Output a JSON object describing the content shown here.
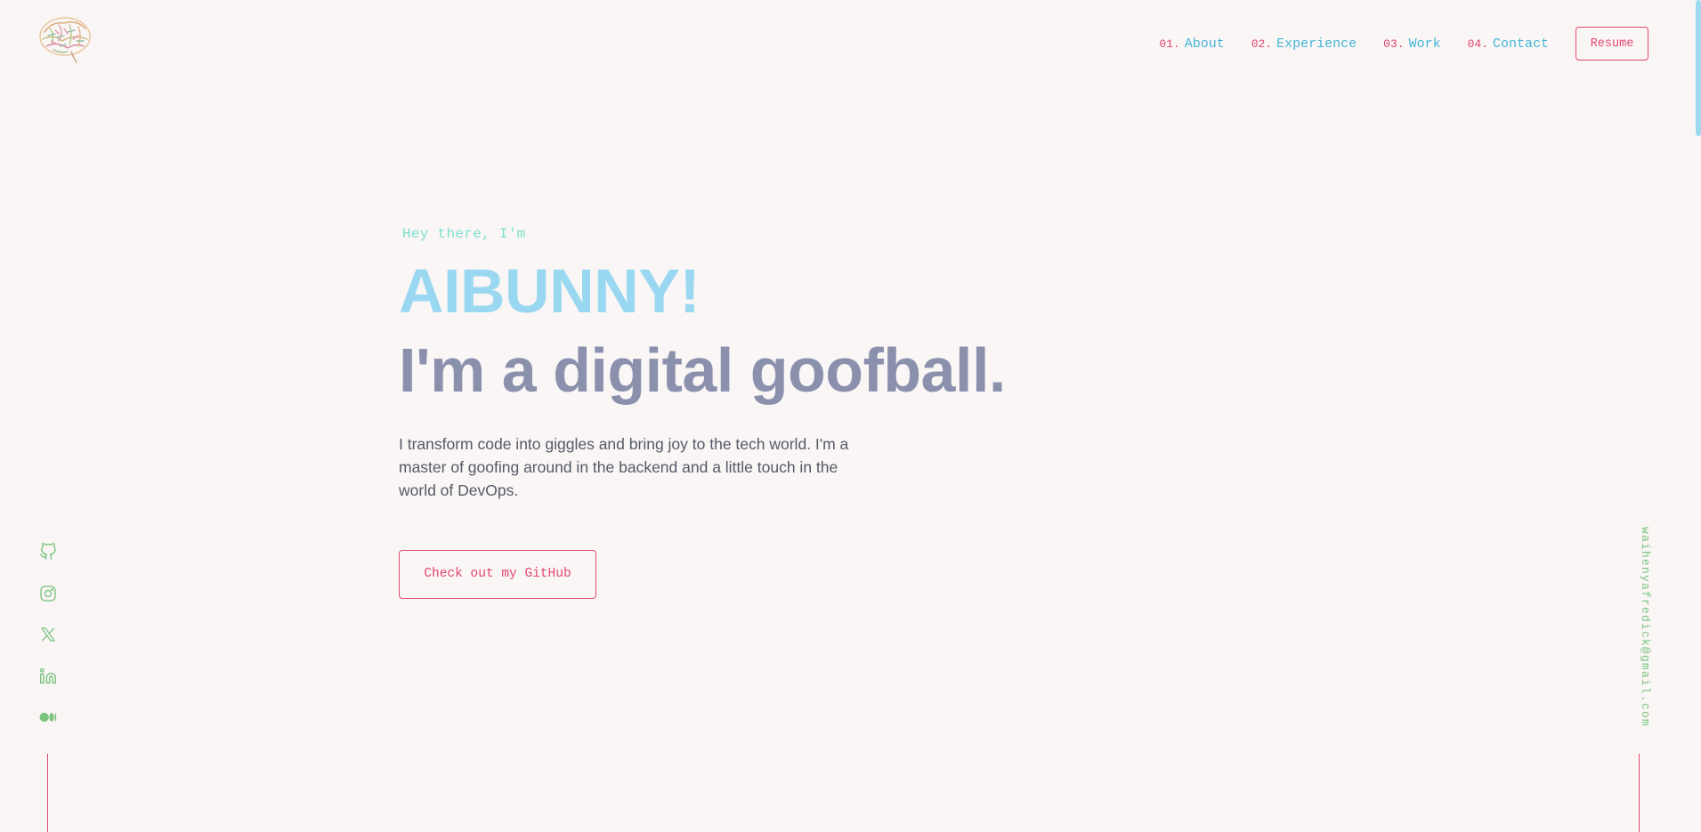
{
  "header": {
    "logo_icon": "brain-icon",
    "nav": [
      {
        "num": "01.",
        "label": "About"
      },
      {
        "num": "02.",
        "label": "Experience"
      },
      {
        "num": "03.",
        "label": "Work"
      },
      {
        "num": "04.",
        "label": "Contact"
      }
    ],
    "resume_label": "Resume"
  },
  "hero": {
    "greeting": "Hey there, I'm",
    "name": "AIBUNNY!",
    "tagline": "I'm a digital goofball.",
    "bio": "I transform code into giggles and bring joy to the tech world. I'm a master of goofing around in the backend and a little touch in the world of DevOps.",
    "cta_label": "Check out my GitHub"
  },
  "socials": [
    {
      "icon": "github-icon"
    },
    {
      "icon": "instagram-icon"
    },
    {
      "icon": "x-twitter-icon"
    },
    {
      "icon": "linkedin-icon"
    },
    {
      "icon": "medium-icon"
    }
  ],
  "email": "waihenyafredick@gmail.com",
  "colors": {
    "background": "#faf6f6",
    "accent_pink": "#e0486e",
    "nav_blue": "#46b6d6",
    "name_blue": "#9ad8f1",
    "tagline_slate": "#8b91ad",
    "greeting_mint": "#7ce0cd",
    "social_green": "#7cc47f"
  }
}
